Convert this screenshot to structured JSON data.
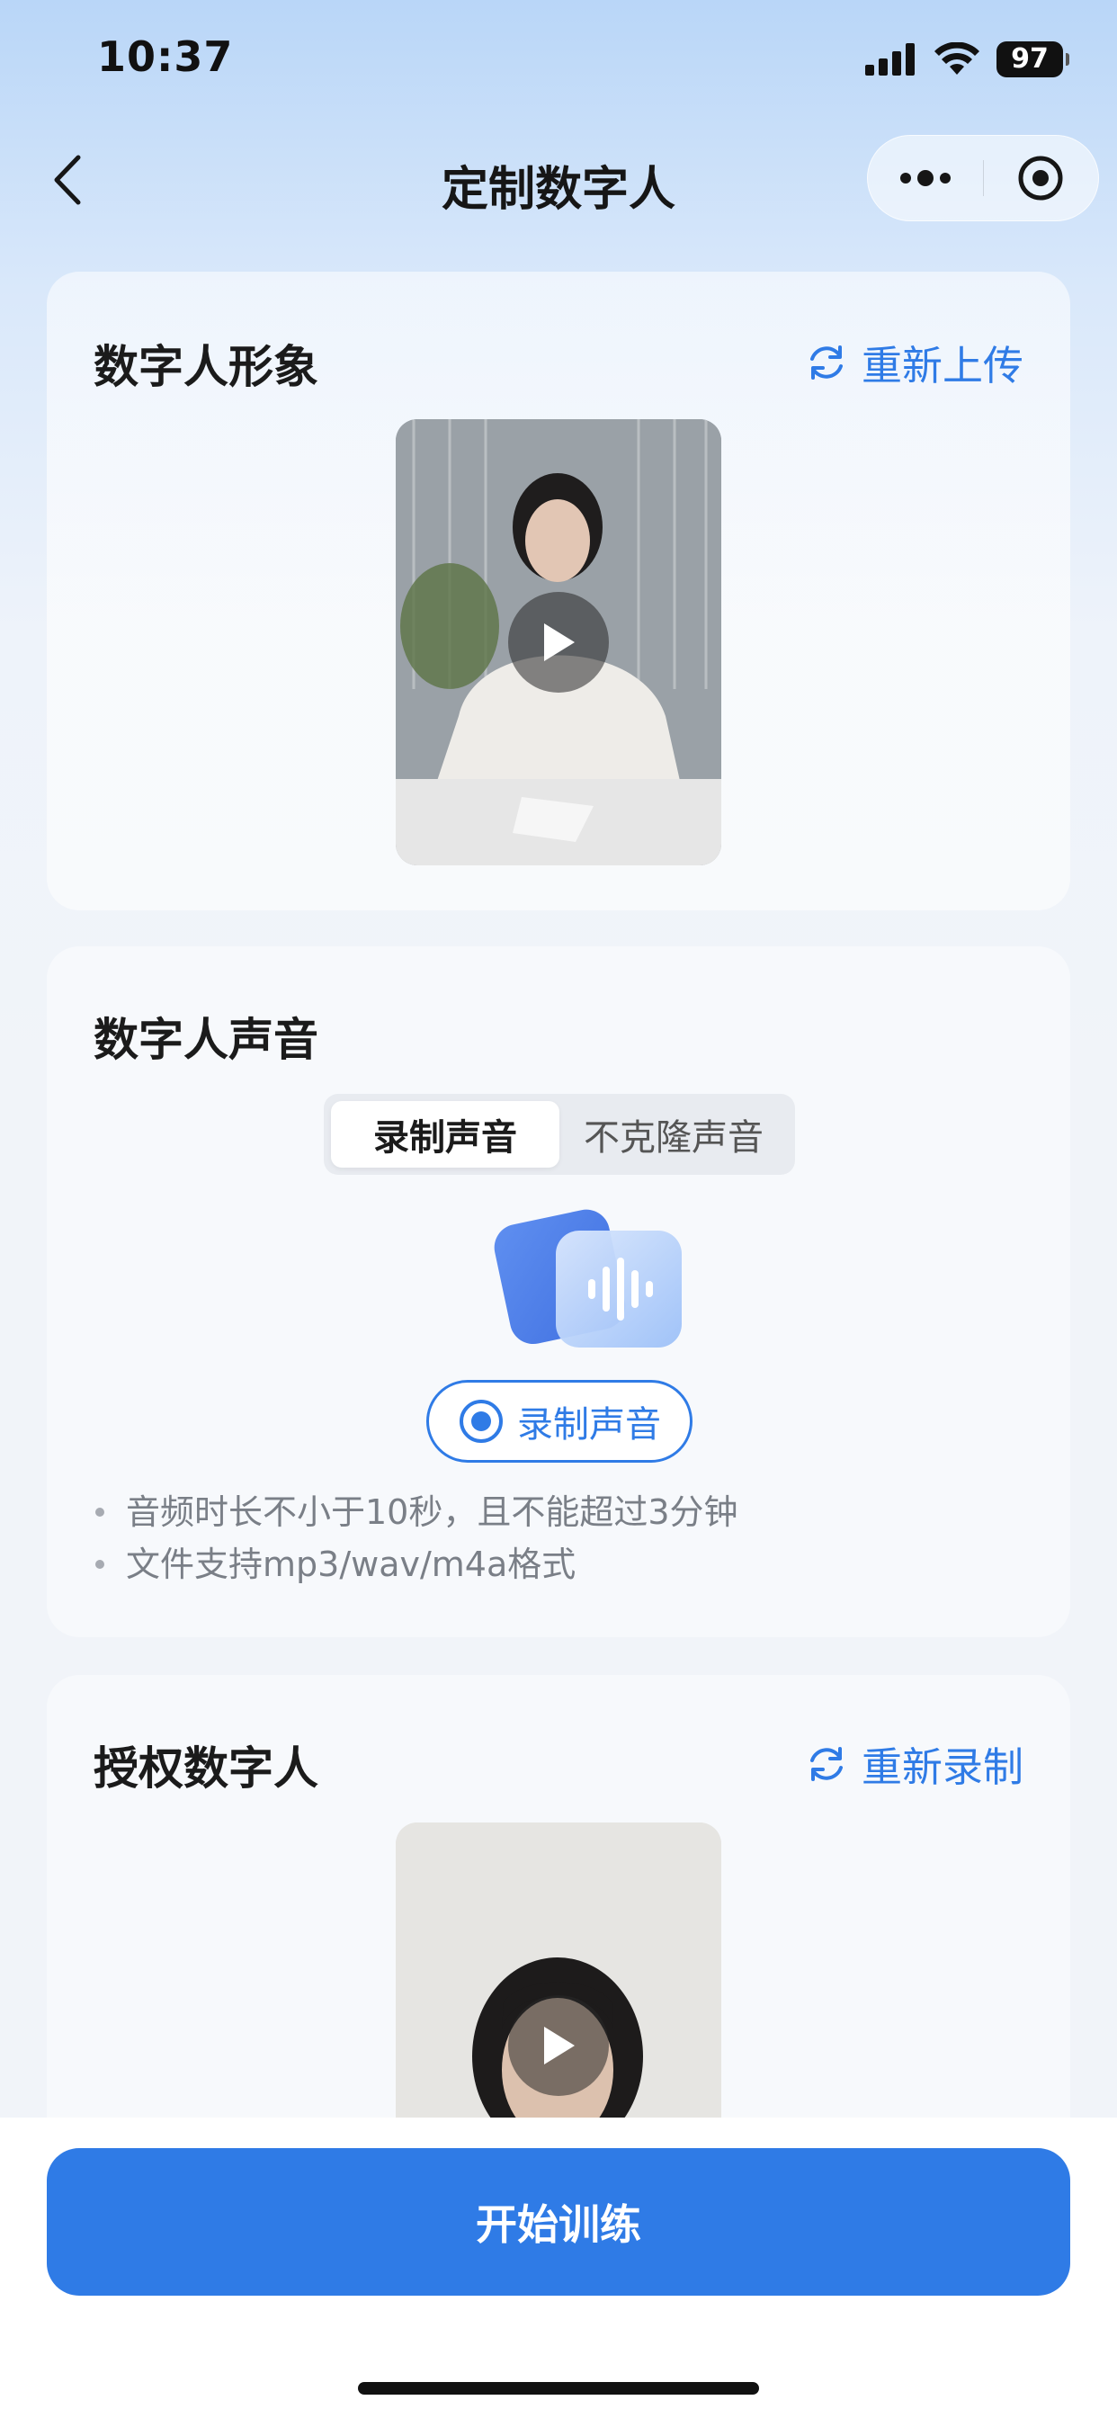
{
  "status_bar": {
    "time": "10:37",
    "battery": "97"
  },
  "nav": {
    "title": "定制数字人"
  },
  "image_section": {
    "title": "数字人形象",
    "action_label": "重新上传"
  },
  "voice_section": {
    "title": "数字人声音",
    "tabs": [
      {
        "label": "录制声音",
        "active": true
      },
      {
        "label": "不克隆声音",
        "active": false
      }
    ],
    "record_button_label": "录制声音",
    "hints": [
      "音频时长不小于10秒，且不能超过3分钟",
      "文件支持mp3/wav/m4a格式"
    ]
  },
  "auth_section": {
    "title": "授权数字人",
    "action_label": "重新录制"
  },
  "bottom": {
    "train_button_label": "开始训练"
  },
  "colors": {
    "accent": "#2f7be6",
    "text_primary": "#1b1b1b",
    "hint_text": "#7a7f87"
  },
  "icons": [
    "back-icon",
    "more-dots-icon",
    "target-close-icon",
    "refresh-icon",
    "play-icon",
    "waveform-icon",
    "record-dot-icon",
    "signal-icon",
    "wifi-icon",
    "battery-icon"
  ]
}
